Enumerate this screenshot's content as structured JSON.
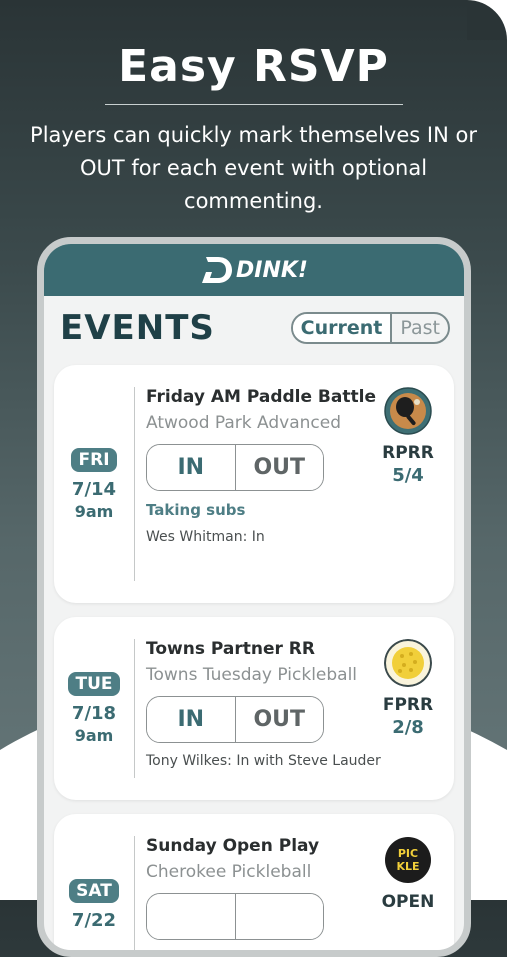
{
  "promo": {
    "headline": "Easy RSVP",
    "subtitle": "Players can quickly mark themselves IN or OUT for each event with optional commenting."
  },
  "app": {
    "logo_text": "DINK!",
    "section_title": "EVENTS",
    "tabs": {
      "current": "Current",
      "past": "Past"
    },
    "events": [
      {
        "day": "FRI",
        "date": "7/14",
        "time": "9am",
        "title": "Friday AM Paddle Battle",
        "location": "Atwood Park Advanced",
        "in_label": "IN",
        "out_label": "OUT",
        "note": "Taking subs",
        "comment": "Wes Whitman: In",
        "code": "RPRR",
        "count": "5/4",
        "badge_icon": "paddle-icon"
      },
      {
        "day": "TUE",
        "date": "7/18",
        "time": "9am",
        "title": "Towns Partner RR",
        "location": "Towns Tuesday Pickleball",
        "in_label": "IN",
        "out_label": "OUT",
        "comment": "Tony Wilkes: In with Steve Lauder",
        "code": "FPRR",
        "count": "2/8",
        "badge_icon": "pickleball-icon"
      },
      {
        "day": "SAT",
        "date": "7/22",
        "title": "Sunday Open Play",
        "location": "Cherokee Pickleball",
        "code": "OPEN",
        "badge_icon": "pickle-logo-icon",
        "badge_text": "PICKLE"
      }
    ]
  },
  "colors": {
    "accent": "#3b6b72",
    "day_badge": "#4e7e85",
    "background_top": "#2a3436"
  }
}
